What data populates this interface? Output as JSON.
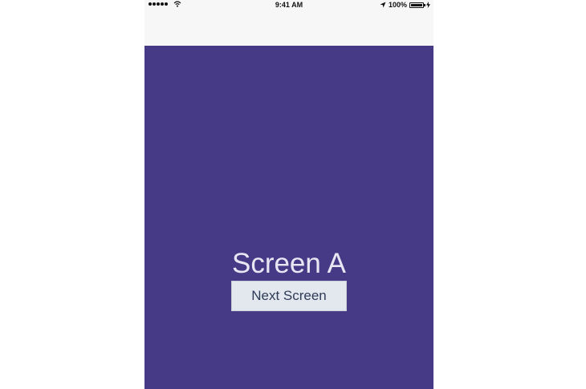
{
  "status_bar": {
    "time": "9:41 AM",
    "battery_text": "100%",
    "battery_level": 1.0,
    "icons": [
      "signal-icon",
      "wifi-icon",
      "location-icon",
      "battery-icon",
      "charging-icon"
    ]
  },
  "screen": {
    "title": "Screen A",
    "button_label": "Next Screen",
    "background_color": "#463a87",
    "nav_color": "#f7f7f7"
  }
}
